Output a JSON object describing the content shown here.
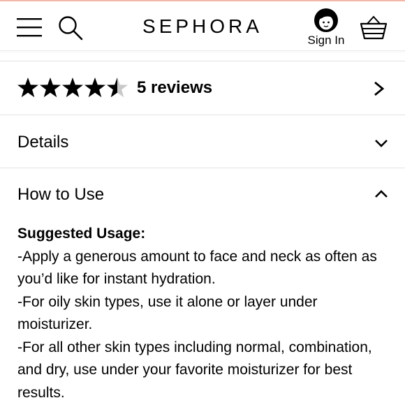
{
  "header": {
    "logo": "SEPHORA",
    "sign_in_label": "Sign In",
    "icons": [
      "menu-icon",
      "search-icon",
      "avatar-icon",
      "basket-icon"
    ]
  },
  "reviews": {
    "rating": 4.5,
    "max_rating": 5,
    "label": "5 reviews"
  },
  "details": {
    "title": "Details"
  },
  "how_to_use": {
    "title": "How to Use",
    "usage_title": "Suggested Usage:",
    "lines": [
      "-Apply a generous amount to face and neck as often as you’d like for instant hydration.",
      "-For oily skin types, use it alone or layer under moisturizer.",
      "-For all other skin types including normal, combination, and dry, use under your favorite moisturizer for best results."
    ]
  },
  "colors": {
    "top_accent": "#f3b7aa",
    "divider": "#e2e2e2",
    "star_filled": "#000000",
    "star_empty": "#c9c9c9"
  }
}
